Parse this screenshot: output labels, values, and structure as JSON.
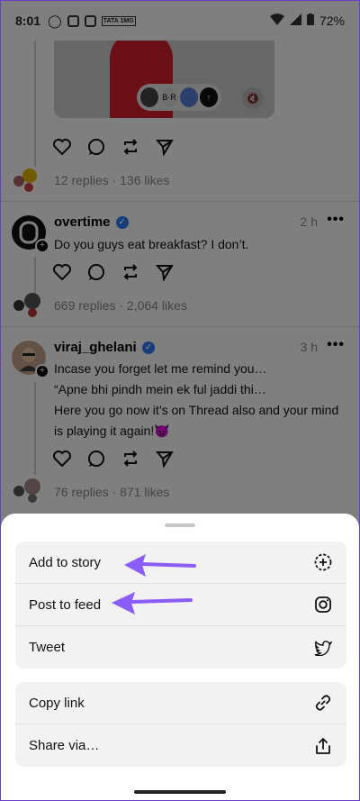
{
  "status_bar": {
    "time": "8:01",
    "battery": "72%",
    "tata_label": "TATA 1MG"
  },
  "top_post": {
    "pill_avatar_text": "B·R",
    "replies_likes": "12 replies · 136 likes"
  },
  "post1": {
    "username": "overtime",
    "time": "2 h",
    "text": "Do you guys eat breakfast? I don’t.",
    "replies_likes": "669 replies · 2,064 likes"
  },
  "post2": {
    "username": "viraj_ghelani",
    "time": "3 h",
    "text_lines": [
      "Incase you forget let me remind you…",
      "“Apne bhi pindh mein ek ful jaddi thi…",
      "Here you go now it’s on Thread also and your mind",
      "is playing it again!😈"
    ],
    "replies_likes": "76 replies · 871 likes"
  },
  "sheet": {
    "group1": [
      {
        "label": "Add to story",
        "icon": "add-circle-icon"
      },
      {
        "label": "Post to feed",
        "icon": "instagram-icon"
      },
      {
        "label": "Tweet",
        "icon": "twitter-icon"
      }
    ],
    "group2": [
      {
        "label": "Copy link",
        "icon": "link-icon"
      },
      {
        "label": "Share via…",
        "icon": "share-icon"
      }
    ]
  },
  "colors": {
    "accent_arrow": "#8b5cf6",
    "verified": "#2f7bf5",
    "media_red": "#d21e2a"
  }
}
